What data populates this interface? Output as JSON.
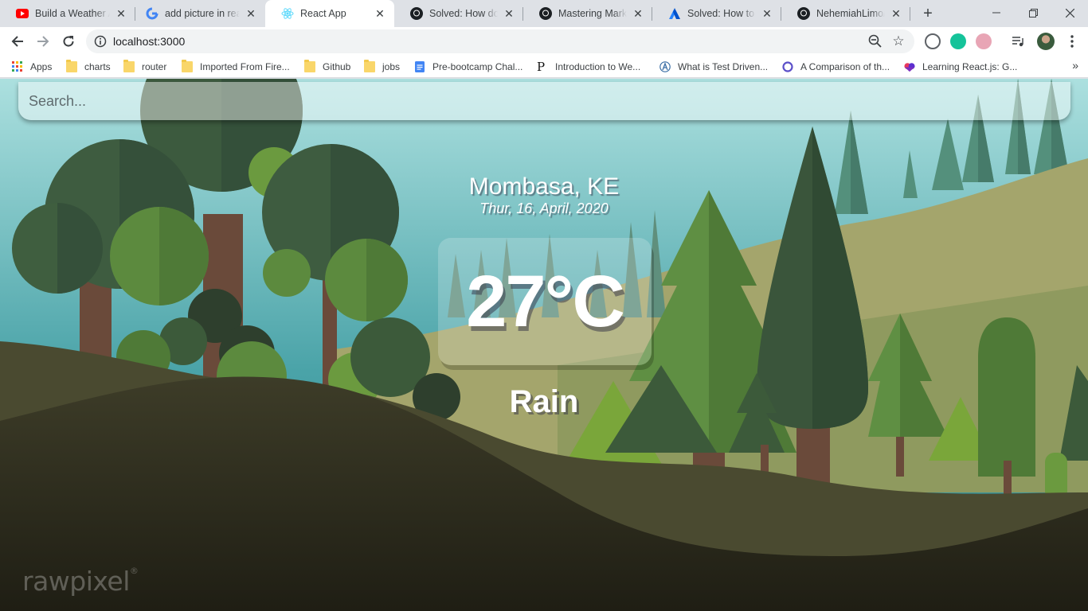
{
  "browser": {
    "tabs": [
      {
        "title": "Build a Weather App",
        "icon": "youtube-icon",
        "active": false
      },
      {
        "title": "add picture in react",
        "icon": "google-icon",
        "active": false
      },
      {
        "title": "React App",
        "icon": "react-icon",
        "active": true
      },
      {
        "title": "Solved: How do you",
        "icon": "github-icon",
        "active": false
      },
      {
        "title": "Mastering Markdown",
        "icon": "github-icon",
        "active": false
      },
      {
        "title": "Solved: How to add",
        "icon": "atlassian-icon",
        "active": false
      },
      {
        "title": "NehemiahLimo/We",
        "icon": "github-icon",
        "active": false
      }
    ],
    "close_glyph": "✕",
    "new_tab_glyph": "+",
    "address": "localhost:3000",
    "bookmarks": [
      {
        "label": "Apps",
        "icon": "apps-grid-icon"
      },
      {
        "label": "charts",
        "icon": "folder-icon"
      },
      {
        "label": "router",
        "icon": "folder-icon"
      },
      {
        "label": "Imported From Fire...",
        "icon": "folder-icon"
      },
      {
        "label": "Github",
        "icon": "folder-icon"
      },
      {
        "label": "jobs",
        "icon": "folder-icon"
      },
      {
        "label": "Pre-bootcamp Chal...",
        "icon": "google-docs-icon"
      },
      {
        "label": "Introduction to We...",
        "icon": "p-logo-icon"
      },
      {
        "label": "What is Test Driven...",
        "icon": "a-logo-icon"
      },
      {
        "label": "A Comparison of th...",
        "icon": "ring-logo-icon"
      },
      {
        "label": "Learning React.js: G...",
        "icon": "heart-logo-icon"
      }
    ],
    "more_glyph": "»"
  },
  "app": {
    "search_placeholder": "Search...",
    "location": "Mombasa, KE",
    "date": "Thur, 16, April, 2020",
    "temperature": "27°C",
    "weather": "Rain",
    "watermark": "rawpixel"
  },
  "colors": {
    "sky_top": "#a8dcdc",
    "sky_bottom": "#3f9ca4",
    "hill_dark": "#3b3b28",
    "hill_mid": "#a3a66a",
    "tree_dark": "#344e38",
    "tree_mid": "#4f7a45",
    "tree_light": "#6d9a3a"
  }
}
